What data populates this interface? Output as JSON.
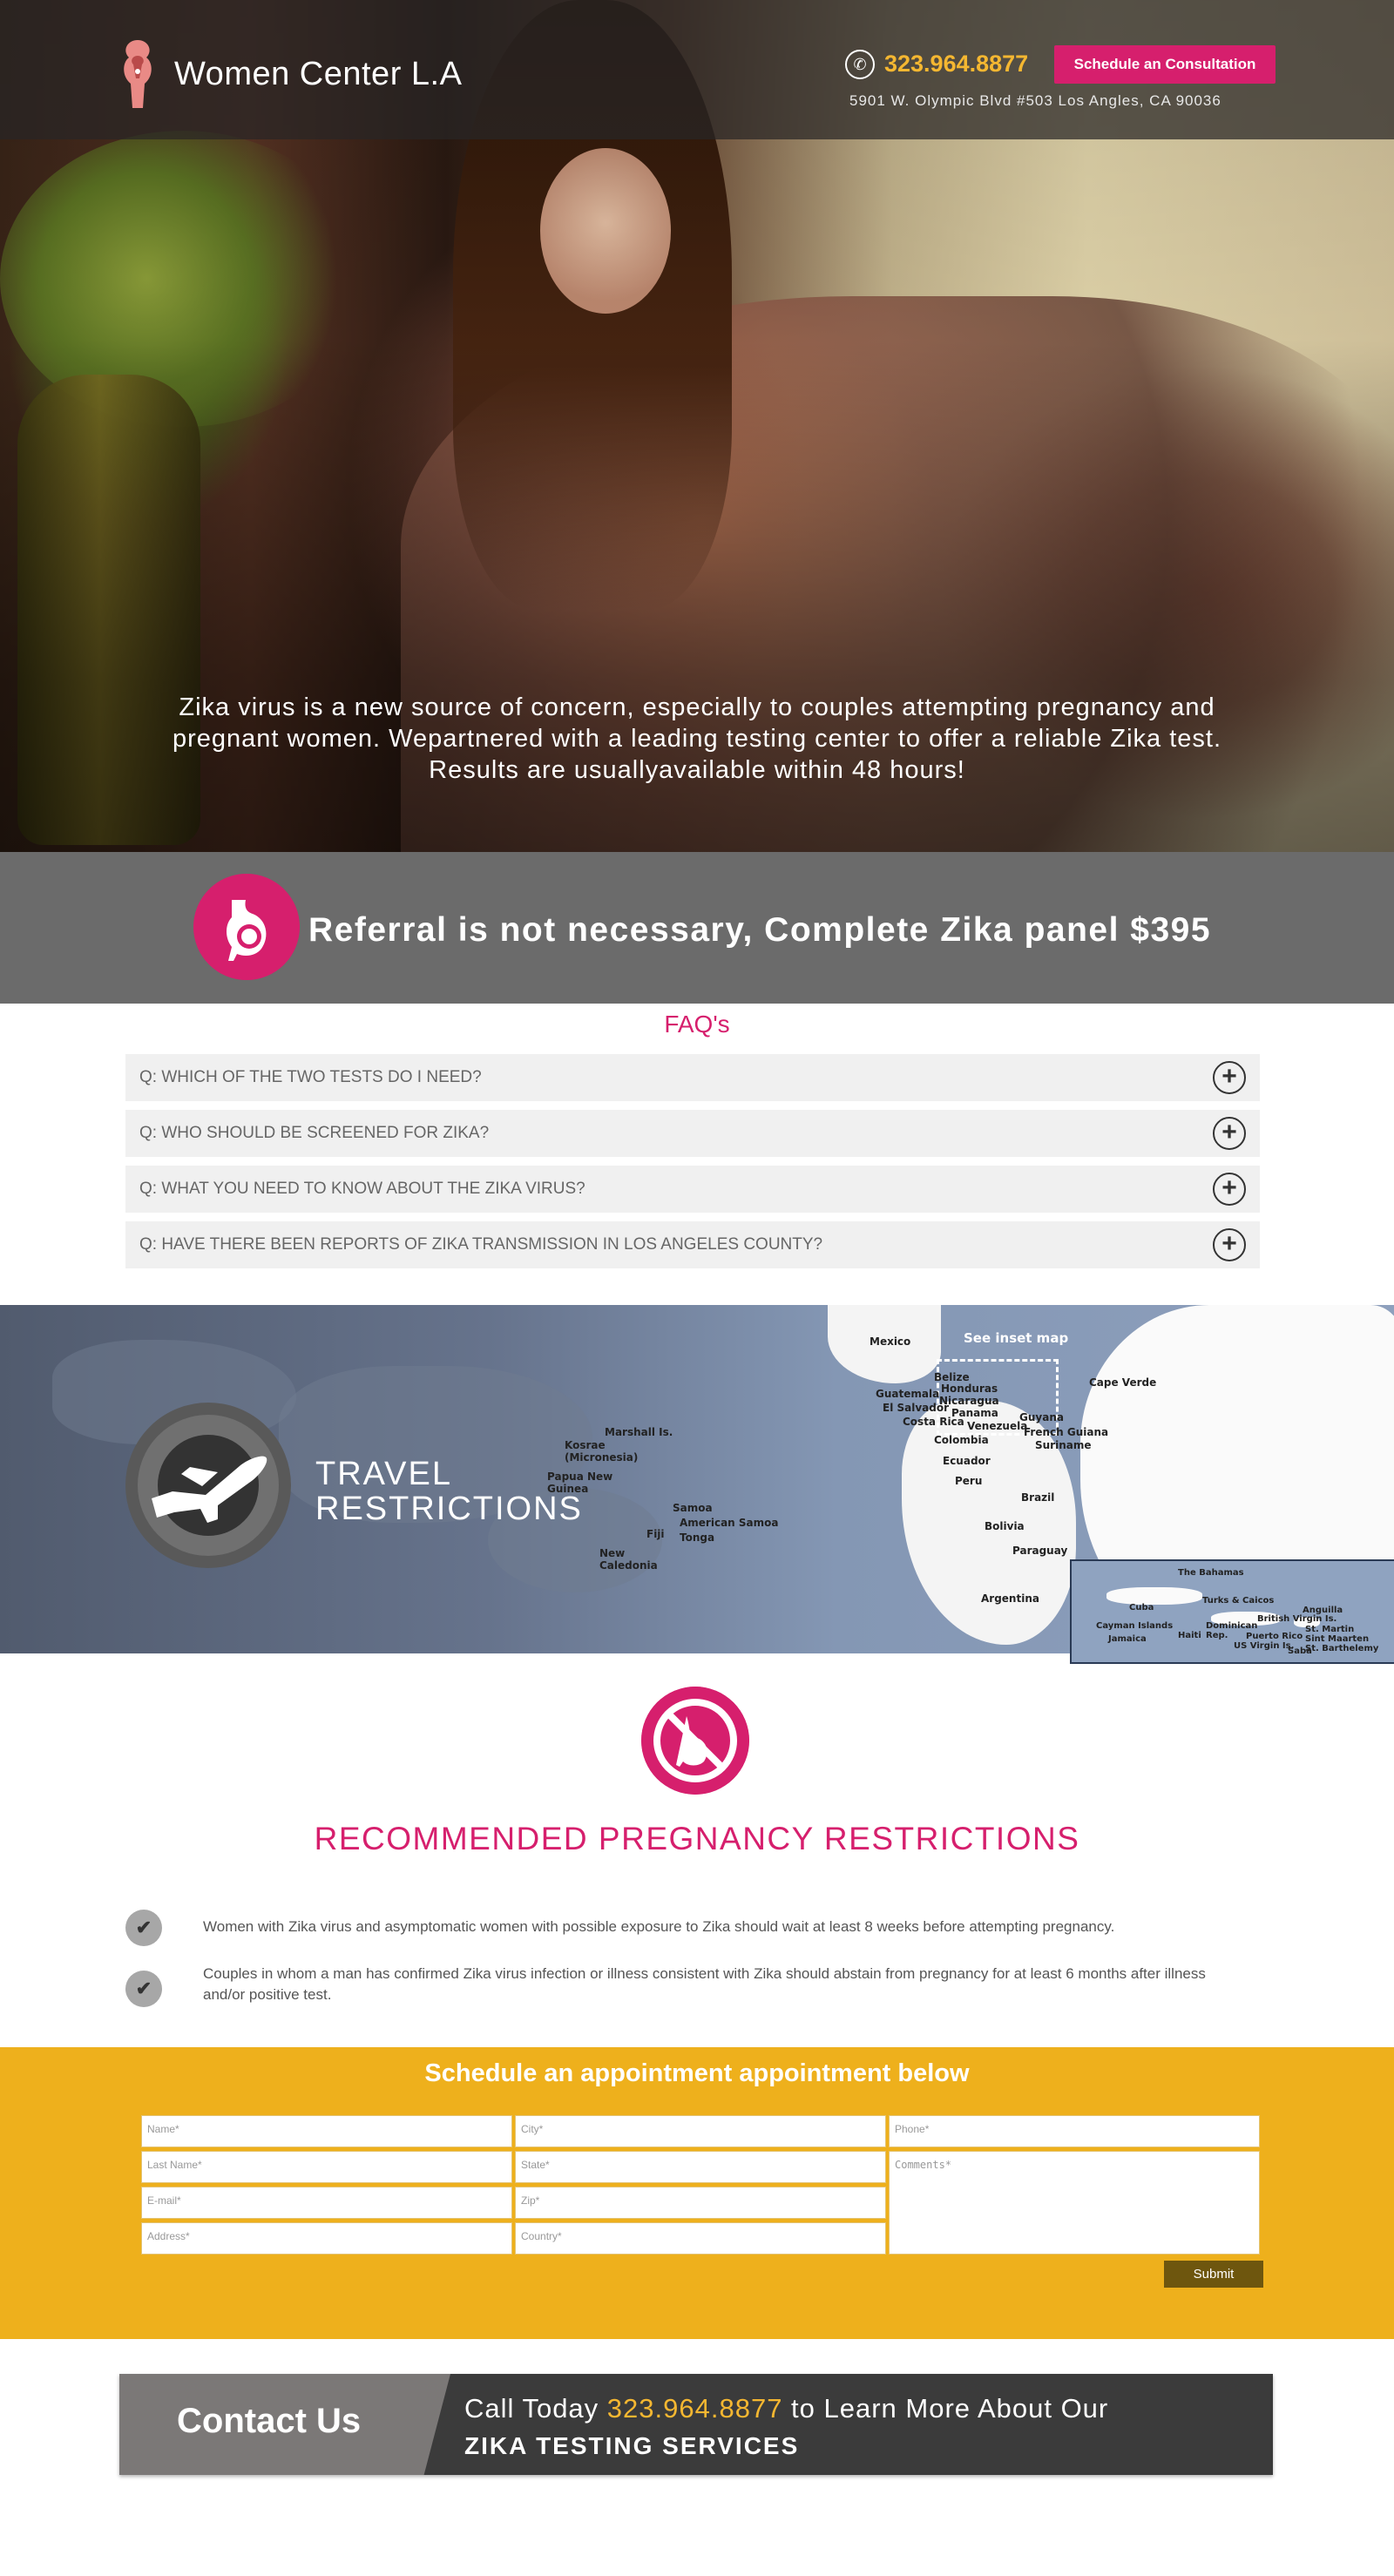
{
  "header": {
    "brand": "Women Center L.A",
    "phone": "323.964.8877",
    "consult_button": "Schedule an Consultation",
    "address": "5901 W. Olympic Blvd #503 Los Angles, CA 90036"
  },
  "hero": {
    "text": "Zika virus is a new source of concern, especially to couples attempting pregnancy and pregnant women. Wepartnered with a leading testing center to offer a reliable Zika test. Results are usuallyavailable within 48 hours!"
  },
  "referral": {
    "text": "Referral is not necessary, Complete Zika panel $395"
  },
  "faq": {
    "title": "FAQ's",
    "items": [
      {
        "question": "Q: WHICH OF THE TWO TESTS DO I NEED?"
      },
      {
        "question": "Q: WHO SHOULD BE SCREENED FOR ZIKA?"
      },
      {
        "question": "Q: WHAT YOU NEED TO KNOW ABOUT THE ZIKA VIRUS?"
      },
      {
        "question": "Q: HAVE THERE BEEN REPORTS OF ZIKA TRANSMISSION IN LOS ANGELES COUNTY?"
      }
    ],
    "expand_symbol": "+"
  },
  "travel": {
    "title_line1": "TRAVEL",
    "title_line2": "RESTRICTIONS",
    "map_labels": {
      "inset": "See inset map",
      "mexico": "Mexico",
      "belize": "Belize",
      "honduras": "Honduras",
      "guatemala": "Guatemala",
      "nicaragua": "Nicaragua",
      "el_salvador": "El Salvador",
      "panama": "Panama",
      "costa_rica": "Costa Rica",
      "venezuela": "Venezuela",
      "guyana": "Guyana",
      "french_guiana": "French Guiana",
      "suriname": "Suriname",
      "colombia": "Colombia",
      "ecuador": "Ecuador",
      "peru": "Peru",
      "brazil": "Brazil",
      "bolivia": "Bolivia",
      "paraguay": "Paraguay",
      "argentina": "Argentina",
      "cape_verde": "Cape Verde",
      "marshall": "Marshall Is.",
      "kosrae": "Kosrae (Micronesia)",
      "papua": "Papua New Guinea",
      "samoa": "Samoa",
      "american_samoa": "American Samoa",
      "fiji": "Fiji",
      "tonga": "Tonga",
      "new_caledonia": "New Caledonia",
      "bahamas": "The Bahamas",
      "cuba": "Cuba",
      "turks": "Turks & Caicos",
      "anguilla": "Anguilla",
      "bvi": "British Virgin Is.",
      "st_martin": "St. Martin",
      "sint_maarten": "Sint Maarten",
      "st_barthelemy": "St. Barthelemy",
      "cayman": "Cayman Islands",
      "jamaica": "Jamaica",
      "haiti": "Haiti",
      "dominican": "Dominican Rep.",
      "puerto_rico": "Puerto Rico",
      "usvi": "US Virgin Is.",
      "saba": "Saba"
    }
  },
  "restrictions": {
    "title": "RECOMMENDED PREGNANCY RESTRICTIONS",
    "items": [
      {
        "text": "Women with Zika virus and asymptomatic women with possible exposure to Zika should wait at least 8 weeks before attempting pregnancy."
      },
      {
        "text": "Couples in whom a man has confirmed Zika virus infection or illness consistent with Zika should abstain from pregnancy for at least 6 months after illness and/or positive test."
      }
    ],
    "check_symbol": "✔"
  },
  "appointment": {
    "title": "Schedule an appointment appointment below",
    "placeholders": {
      "name": "Name*",
      "last_name": "Last Name*",
      "email": "E-mail*",
      "address": "Address*",
      "city": "City*",
      "state": "State*",
      "zip": "Zip*",
      "country": "Country*",
      "phone": "Phone*",
      "comments": "Comments*"
    },
    "submit": "Submit"
  },
  "contact": {
    "label": "Contact Us",
    "line1_prefix": "Call Today ",
    "phone": "323.964.8877",
    "line1_suffix": " to Learn More About Our",
    "line2": "ZIKA TESTING SERVICES"
  },
  "colors": {
    "accent": "#d61f6d",
    "gold": "#eeb01c",
    "phone_highlight": "#f5b731"
  },
  "icons": {
    "logo": "uterus-logo-icon",
    "phone": "phone-icon",
    "pregnancy": "pregnant-belly-icon",
    "plane": "airplane-icon",
    "no_pregnancy": "no-pregnancy-icon",
    "check": "check-icon",
    "plus": "plus-circle-icon"
  }
}
